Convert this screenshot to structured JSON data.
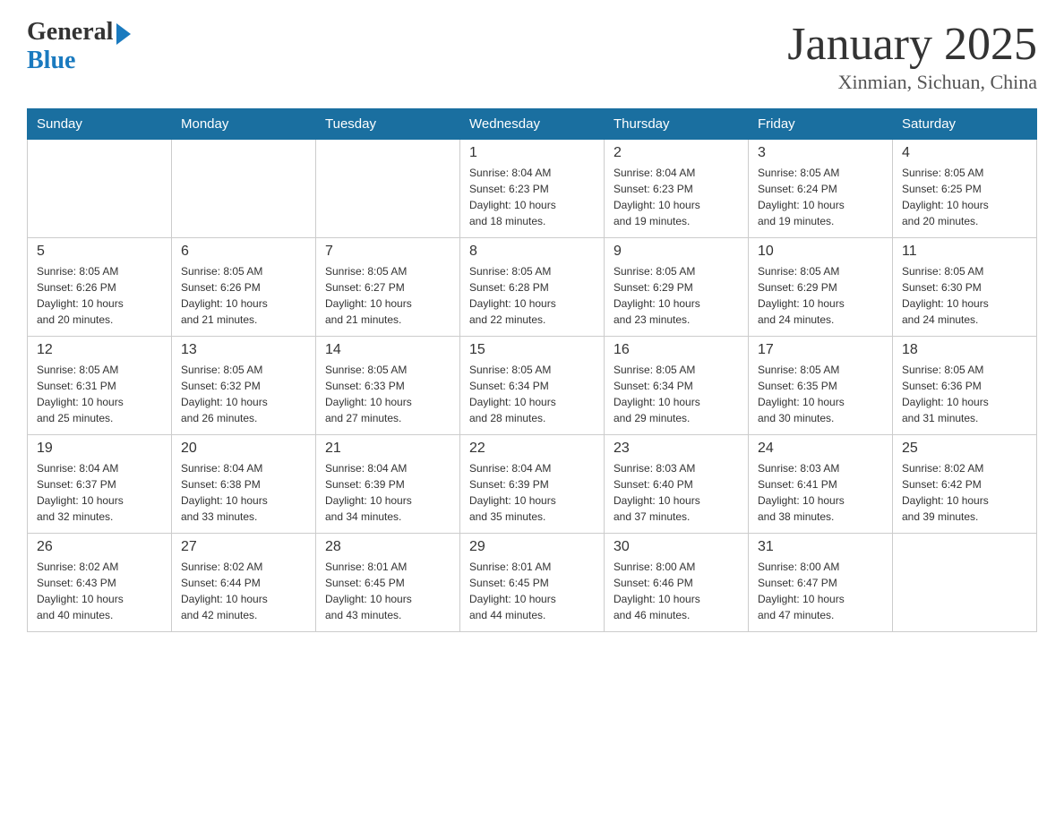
{
  "header": {
    "logo_general": "General",
    "logo_blue": "Blue",
    "title": "January 2025",
    "subtitle": "Xinmian, Sichuan, China"
  },
  "days_of_week": [
    "Sunday",
    "Monday",
    "Tuesday",
    "Wednesday",
    "Thursday",
    "Friday",
    "Saturday"
  ],
  "weeks": [
    {
      "days": [
        {
          "num": "",
          "info": ""
        },
        {
          "num": "",
          "info": ""
        },
        {
          "num": "",
          "info": ""
        },
        {
          "num": "1",
          "info": "Sunrise: 8:04 AM\nSunset: 6:23 PM\nDaylight: 10 hours\nand 18 minutes."
        },
        {
          "num": "2",
          "info": "Sunrise: 8:04 AM\nSunset: 6:23 PM\nDaylight: 10 hours\nand 19 minutes."
        },
        {
          "num": "3",
          "info": "Sunrise: 8:05 AM\nSunset: 6:24 PM\nDaylight: 10 hours\nand 19 minutes."
        },
        {
          "num": "4",
          "info": "Sunrise: 8:05 AM\nSunset: 6:25 PM\nDaylight: 10 hours\nand 20 minutes."
        }
      ]
    },
    {
      "days": [
        {
          "num": "5",
          "info": "Sunrise: 8:05 AM\nSunset: 6:26 PM\nDaylight: 10 hours\nand 20 minutes."
        },
        {
          "num": "6",
          "info": "Sunrise: 8:05 AM\nSunset: 6:26 PM\nDaylight: 10 hours\nand 21 minutes."
        },
        {
          "num": "7",
          "info": "Sunrise: 8:05 AM\nSunset: 6:27 PM\nDaylight: 10 hours\nand 21 minutes."
        },
        {
          "num": "8",
          "info": "Sunrise: 8:05 AM\nSunset: 6:28 PM\nDaylight: 10 hours\nand 22 minutes."
        },
        {
          "num": "9",
          "info": "Sunrise: 8:05 AM\nSunset: 6:29 PM\nDaylight: 10 hours\nand 23 minutes."
        },
        {
          "num": "10",
          "info": "Sunrise: 8:05 AM\nSunset: 6:29 PM\nDaylight: 10 hours\nand 24 minutes."
        },
        {
          "num": "11",
          "info": "Sunrise: 8:05 AM\nSunset: 6:30 PM\nDaylight: 10 hours\nand 24 minutes."
        }
      ]
    },
    {
      "days": [
        {
          "num": "12",
          "info": "Sunrise: 8:05 AM\nSunset: 6:31 PM\nDaylight: 10 hours\nand 25 minutes."
        },
        {
          "num": "13",
          "info": "Sunrise: 8:05 AM\nSunset: 6:32 PM\nDaylight: 10 hours\nand 26 minutes."
        },
        {
          "num": "14",
          "info": "Sunrise: 8:05 AM\nSunset: 6:33 PM\nDaylight: 10 hours\nand 27 minutes."
        },
        {
          "num": "15",
          "info": "Sunrise: 8:05 AM\nSunset: 6:34 PM\nDaylight: 10 hours\nand 28 minutes."
        },
        {
          "num": "16",
          "info": "Sunrise: 8:05 AM\nSunset: 6:34 PM\nDaylight: 10 hours\nand 29 minutes."
        },
        {
          "num": "17",
          "info": "Sunrise: 8:05 AM\nSunset: 6:35 PM\nDaylight: 10 hours\nand 30 minutes."
        },
        {
          "num": "18",
          "info": "Sunrise: 8:05 AM\nSunset: 6:36 PM\nDaylight: 10 hours\nand 31 minutes."
        }
      ]
    },
    {
      "days": [
        {
          "num": "19",
          "info": "Sunrise: 8:04 AM\nSunset: 6:37 PM\nDaylight: 10 hours\nand 32 minutes."
        },
        {
          "num": "20",
          "info": "Sunrise: 8:04 AM\nSunset: 6:38 PM\nDaylight: 10 hours\nand 33 minutes."
        },
        {
          "num": "21",
          "info": "Sunrise: 8:04 AM\nSunset: 6:39 PM\nDaylight: 10 hours\nand 34 minutes."
        },
        {
          "num": "22",
          "info": "Sunrise: 8:04 AM\nSunset: 6:39 PM\nDaylight: 10 hours\nand 35 minutes."
        },
        {
          "num": "23",
          "info": "Sunrise: 8:03 AM\nSunset: 6:40 PM\nDaylight: 10 hours\nand 37 minutes."
        },
        {
          "num": "24",
          "info": "Sunrise: 8:03 AM\nSunset: 6:41 PM\nDaylight: 10 hours\nand 38 minutes."
        },
        {
          "num": "25",
          "info": "Sunrise: 8:02 AM\nSunset: 6:42 PM\nDaylight: 10 hours\nand 39 minutes."
        }
      ]
    },
    {
      "days": [
        {
          "num": "26",
          "info": "Sunrise: 8:02 AM\nSunset: 6:43 PM\nDaylight: 10 hours\nand 40 minutes."
        },
        {
          "num": "27",
          "info": "Sunrise: 8:02 AM\nSunset: 6:44 PM\nDaylight: 10 hours\nand 42 minutes."
        },
        {
          "num": "28",
          "info": "Sunrise: 8:01 AM\nSunset: 6:45 PM\nDaylight: 10 hours\nand 43 minutes."
        },
        {
          "num": "29",
          "info": "Sunrise: 8:01 AM\nSunset: 6:45 PM\nDaylight: 10 hours\nand 44 minutes."
        },
        {
          "num": "30",
          "info": "Sunrise: 8:00 AM\nSunset: 6:46 PM\nDaylight: 10 hours\nand 46 minutes."
        },
        {
          "num": "31",
          "info": "Sunrise: 8:00 AM\nSunset: 6:47 PM\nDaylight: 10 hours\nand 47 minutes."
        },
        {
          "num": "",
          "info": ""
        }
      ]
    }
  ]
}
